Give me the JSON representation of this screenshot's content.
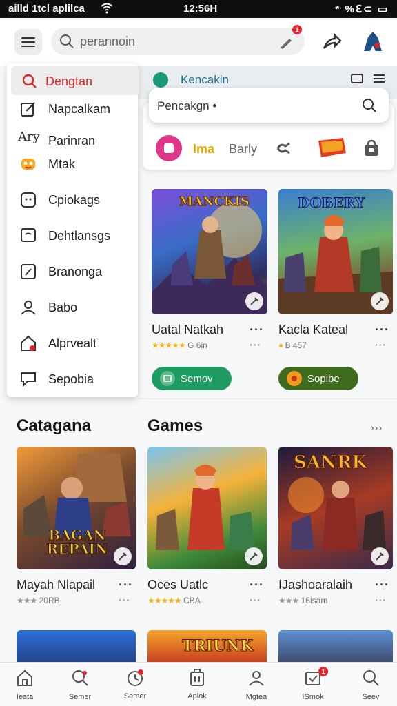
{
  "status_bar": {
    "left": "ailld 1tcl aplilca",
    "time": "12:56H",
    "right": "* %ℇ⊂ ▭"
  },
  "search": {
    "placeholder": "perannoin",
    "badge": "1"
  },
  "drawer": {
    "items": [
      {
        "label": "Dengtan",
        "icon": "search-icon",
        "active": true
      },
      {
        "label": "Napcalkam",
        "icon": "edit-icon"
      },
      {
        "label": "Parinran",
        "prefix": "Ary",
        "icon": "none"
      },
      {
        "label": "Mtak",
        "icon": "emoji-icon"
      },
      {
        "label": "Cpiokags",
        "icon": "face-icon"
      },
      {
        "label": "Dehtlansgs",
        "icon": "chat-icon"
      },
      {
        "label": "Branonga",
        "icon": "pencil-box-icon"
      },
      {
        "label": "Babo",
        "icon": "person-icon"
      },
      {
        "label": "Alprvealt",
        "icon": "house-alert-icon"
      },
      {
        "label": "Sepobia",
        "icon": "feedback-icon"
      }
    ]
  },
  "strip": {
    "title": "Kencakin"
  },
  "popup": {
    "text": "Pencakgn •"
  },
  "chips": [
    {
      "label": "Ima"
    },
    {
      "label": "Barly"
    }
  ],
  "featured": [
    {
      "banner": "MANCKIS",
      "title": "Uatal Natkah",
      "rating_text": "G 6in",
      "button": "Semov",
      "button_color": "#1e9b61"
    },
    {
      "banner": "DOBERY",
      "title": "Kacla Kateal",
      "rating_text": "B 457",
      "button": "Sopibe",
      "button_color": "#3f6b1f"
    }
  ],
  "sections": {
    "left_title": "Catagana",
    "right_title": "Games",
    "see_all": "›››"
  },
  "games": [
    {
      "banner": "BAGAN REPAIN",
      "title": "Mayah Nlapail",
      "rating_text": "20RB",
      "stars": "grey"
    },
    {
      "banner": "",
      "title": "Oces Uatlc",
      "rating_text": "CBA",
      "stars": "gold"
    },
    {
      "banner": "SANRK",
      "title": "IJashoaralaih",
      "rating_text": "16isam",
      "stars": "grey"
    }
  ],
  "bottom_row_banners": [
    "",
    "TRIUNK",
    ""
  ],
  "bottom_nav": [
    {
      "label": "Ieata",
      "icon": "home-icon"
    },
    {
      "label": "Semer",
      "icon": "search-icon"
    },
    {
      "label": "Aplok",
      "icon": "apps-icon"
    },
    {
      "label": "Mgtea",
      "icon": "person-icon"
    },
    {
      "label": "ISmok",
      "icon": "inbox-icon",
      "badge": "1"
    },
    {
      "label": "Seev",
      "icon": "search-icon"
    }
  ]
}
